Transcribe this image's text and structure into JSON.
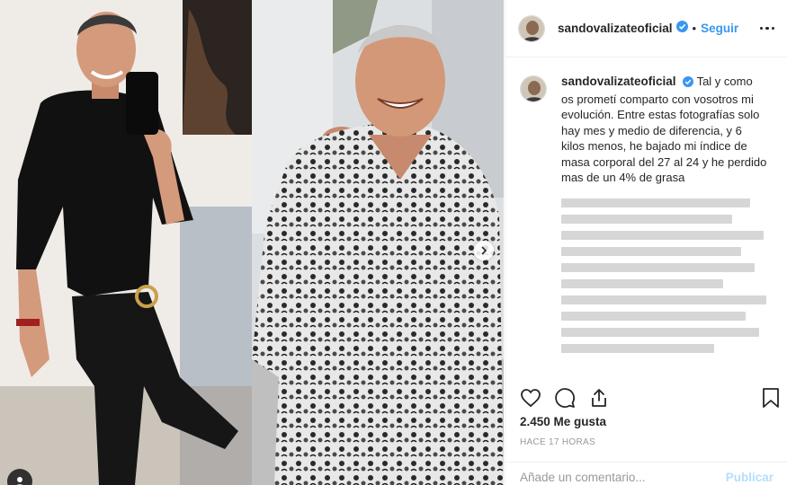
{
  "post": {
    "username": "sandovalizateoficial",
    "follow_label": "Seguir",
    "separator": "•",
    "caption": "Tal y como os prometí comparto con vosotros mi evolución. Entre estas fotografías solo hay mes y medio de diferencia, y 6 kilos menos, he bajado mi índice de masa corporal del 27 al 24 y he perdido mas de un 4% de grasa",
    "likes": "2.450 Me gusta",
    "timestamp": "HACE 17 HORAS",
    "comment_placeholder": "Añade un comentario...",
    "publish_label": "Publicar"
  },
  "colors": {
    "link_blue": "#3897f0",
    "publish_disabled": "#b2dffc",
    "verified_blue": "#3897f0",
    "border": "#efefef"
  },
  "icons": {
    "verified": "verified-badge-icon",
    "like": "heart-icon",
    "comment": "comment-icon",
    "share": "share-icon",
    "save": "bookmark-icon",
    "options": "more-options-icon",
    "next": "chevron-right-icon"
  }
}
